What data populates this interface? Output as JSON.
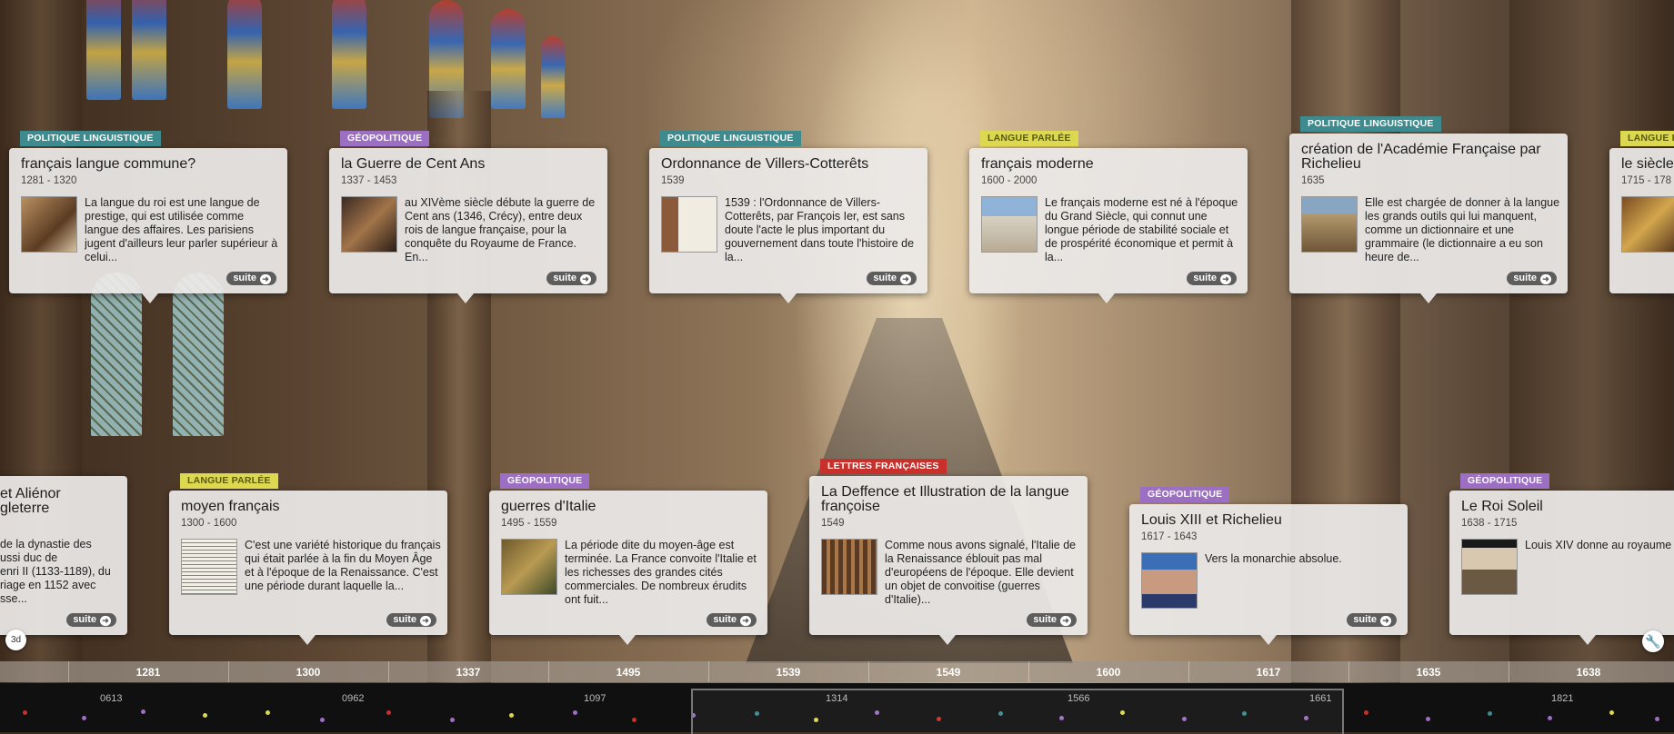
{
  "colors": {
    "geopolitique": "#9c6fc2",
    "politique_linguistique": "#3d8b8e",
    "langue_parlee": "#dcd84f",
    "lettres_francaises": "#c8312b"
  },
  "cards_top": [
    {
      "tag": "Politique linguistique",
      "title": "français langue commune?",
      "dates": "1281 - 1320",
      "text": "La langue du roi est une langue de prestige, qui est utilisée comme langue des affaires. Les parisiens jugent d'ailleurs leur parler supérieur à celui...",
      "more": "suite",
      "icon": "portrait-thumbnail"
    },
    {
      "tag": "Géopolitique",
      "title": "la Guerre de Cent Ans",
      "dates": "1337 - 1453",
      "text": "au XIVème siècle débute la guerre de Cent ans (1346, Crécy), entre deux rois de langue française, pour la conquête du Royaume de France. En...",
      "more": "suite",
      "icon": "painting-thumbnail"
    },
    {
      "tag": "Politique linguistique",
      "title": "Ordonnance de Villers-Cotterêts",
      "dates": "1539",
      "text": "1539 : l'Ordonnance de Villers-Cotterêts, par François Ier, est sans doute l'acte le plus important du gouvernement dans toute l'histoire de la...",
      "more": "suite",
      "icon": "document-thumbnail"
    },
    {
      "tag": "Langue parlée",
      "title": "français moderne",
      "dates": "1600 - 2000",
      "text": "Le français moderne est né à l'époque du Grand Siècle, qui connut une longue période de stabilité sociale et de prospérité économique et permit à la...",
      "more": "suite",
      "icon": "building-thumbnail"
    },
    {
      "tag": "Politique linguistique",
      "title": "création de l'Académie Française par Richelieu",
      "dates": "1635",
      "text": "Elle est chargée de donner à la langue les grands outils qui lui manquent, comme un dictionnaire et une grammaire (le dictionnaire a eu son heure de...",
      "more": "suite",
      "icon": "academy-thumbnail"
    },
    {
      "tag": "Langue p",
      "title": "le siècle",
      "dates": "1715 - 178",
      "text": "",
      "more": "",
      "icon": "painting-thumbnail"
    }
  ],
  "cards_bottom": [
    {
      "tag": "",
      "title": "et Aliénor\ngleterre",
      "dates": "",
      "text": "de la dynastie des\nussi duc de\nenri II (1133-1189), du\nriage en 1152 avec\nsse...",
      "more": "suite",
      "icon": ""
    },
    {
      "tag": "Langue parlée",
      "title": "moyen français",
      "dates": "1300 - 1600",
      "text": "C'est une variété historique du français qui était parlée à la fin du Moyen Âge et à l'époque de la Renaissance. C'est une période durant laquelle la...",
      "more": "suite",
      "icon": "manuscript-thumbnail"
    },
    {
      "tag": "Géopolitique",
      "title": "guerres d'Italie",
      "dates": "1495 - 1559",
      "text": "La période dite du moyen-âge est terminée. La France convoite l'Italie et les richesses des grandes cités commerciales. De nombreux érudits ont fuit...",
      "more": "suite",
      "icon": "painting-thumbnail"
    },
    {
      "tag": "Lettres françaises",
      "title": "La Deffence et Illustration de la langue françoise",
      "dates": "1549",
      "text": "Comme nous avons signalé, l'Italie de la Renaissance éblouit pas mal d'européens de l'époque. Elle devient un objet de convoitise (guerres d'Italie)...",
      "more": "suite",
      "icon": "bookshelf-thumbnail"
    },
    {
      "tag": "Géopolitique",
      "title": "Louis XIII et Richelieu",
      "dates": "1617 - 1643",
      "text": "Vers la monarchie absolue.",
      "more": "suite",
      "icon": "video-thumbnail"
    },
    {
      "tag": "Géopolitique",
      "title": "Le Roi Soleil",
      "dates": "1638 - 1715",
      "text": "Louis XIV donne au royaume contour proche de celui qu'o connaît aujourd'hui et une puissance et un rayonnemen nouveaux. Par son contrôle",
      "more": "",
      "icon": "portrait-thumbnail"
    }
  ],
  "axis_ticks": [
    "1281",
    "1300",
    "1337",
    "1495",
    "1539",
    "1549",
    "1600",
    "1617",
    "1635",
    "1638"
  ],
  "minimap_labels": [
    "0613",
    "0962",
    "1097",
    "1314",
    "1566",
    "1661",
    "1821"
  ],
  "controls": {
    "view_3d": "3d",
    "settings_icon": "wrench-icon"
  }
}
